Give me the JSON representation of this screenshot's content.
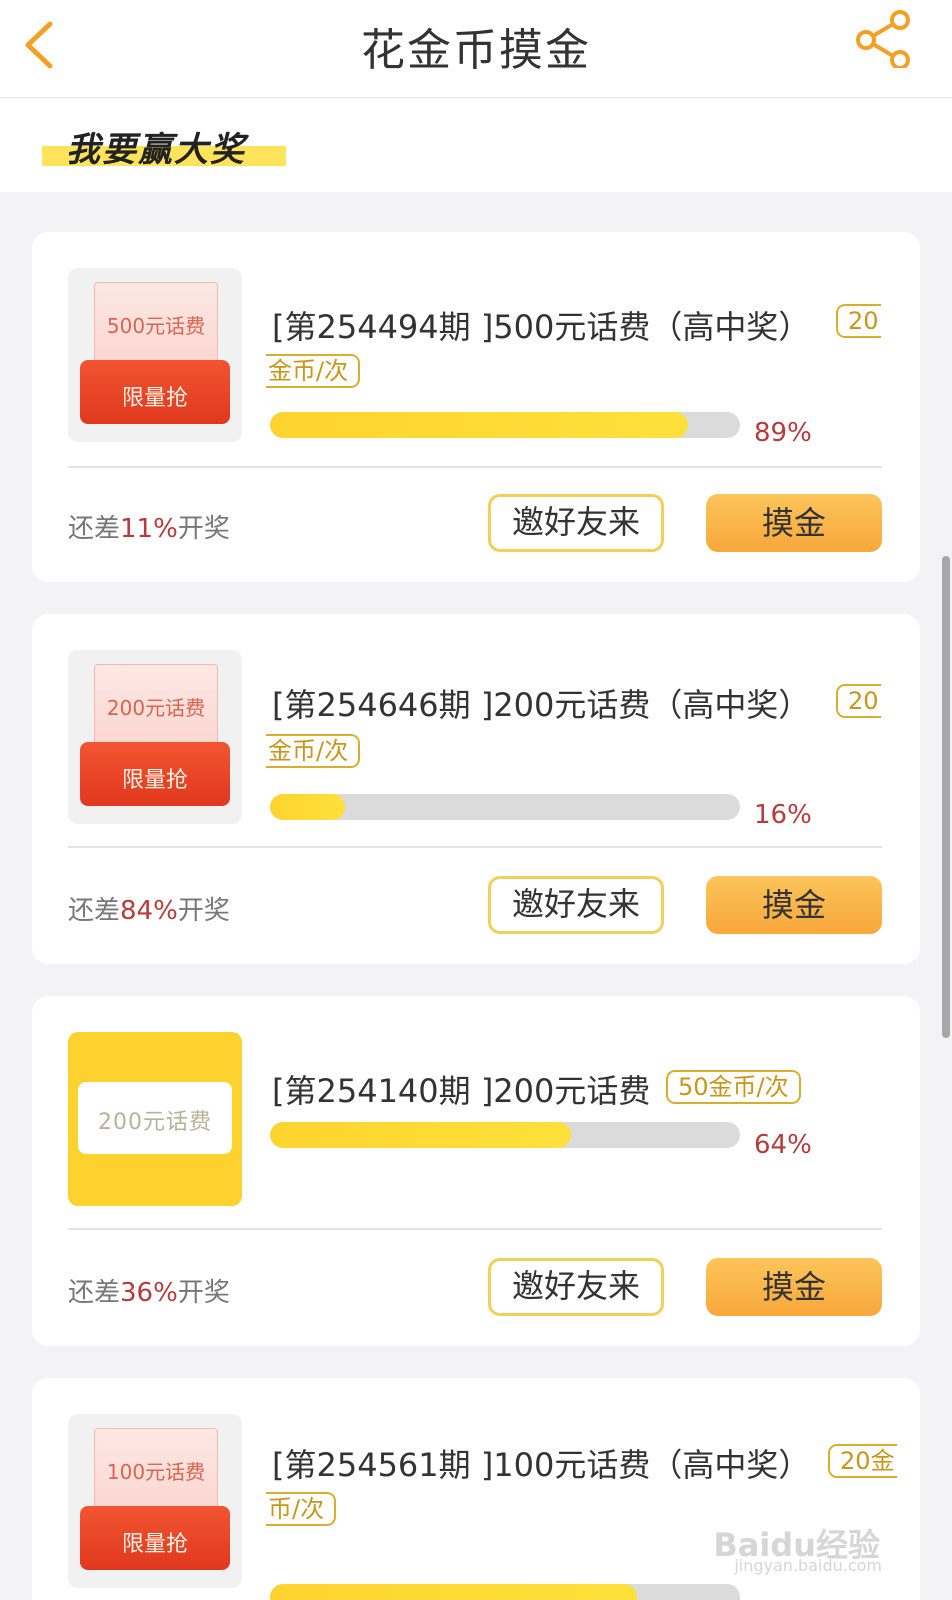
{
  "header": {
    "title": "花金币摸金",
    "back_icon": "chevron-left-icon",
    "share_icon": "share-icon",
    "accent_color": "#f5a024"
  },
  "section": {
    "title": "我要赢大奖"
  },
  "items": [
    {
      "title": "[第254494期 ]500元话费（高中奖）",
      "cost_part1": "20",
      "cost_part2": "金币/次",
      "thumb_label": "500元话费",
      "thumb_badge": "限量抢",
      "progress": 0.89,
      "percent": "89%",
      "remain_prefix": "还差",
      "remain_value": "11%",
      "remain_suffix": "开奖",
      "invite_label": "邀好友来",
      "action_label": "摸金"
    },
    {
      "title": "[第254646期 ]200元话费（高中奖）",
      "cost_part1": "20",
      "cost_part2": "金币/次",
      "thumb_label": "200元话费",
      "thumb_badge": "限量抢",
      "progress": 0.16,
      "percent": "16%",
      "remain_prefix": "还差",
      "remain_value": "84%",
      "remain_suffix": "开奖",
      "invite_label": "邀好友来",
      "action_label": "摸金"
    },
    {
      "title": "[第254140期 ]200元话费",
      "cost": "50金币/次",
      "thumb_label": "200元话费",
      "progress": 0.64,
      "percent": "64%",
      "remain_prefix": "还差",
      "remain_value": "36%",
      "remain_suffix": "开奖",
      "invite_label": "邀好友来",
      "action_label": "摸金"
    },
    {
      "title": "[第254561期 ]100元话费（高中奖）",
      "cost_part1": "20金",
      "cost_part2": "币/次",
      "thumb_label": "100元话费",
      "thumb_badge": "限量抢",
      "progress": 0.78
    }
  ],
  "watermark": {
    "brand": "Baidu经验",
    "url": "jingyan.baidu.com"
  }
}
